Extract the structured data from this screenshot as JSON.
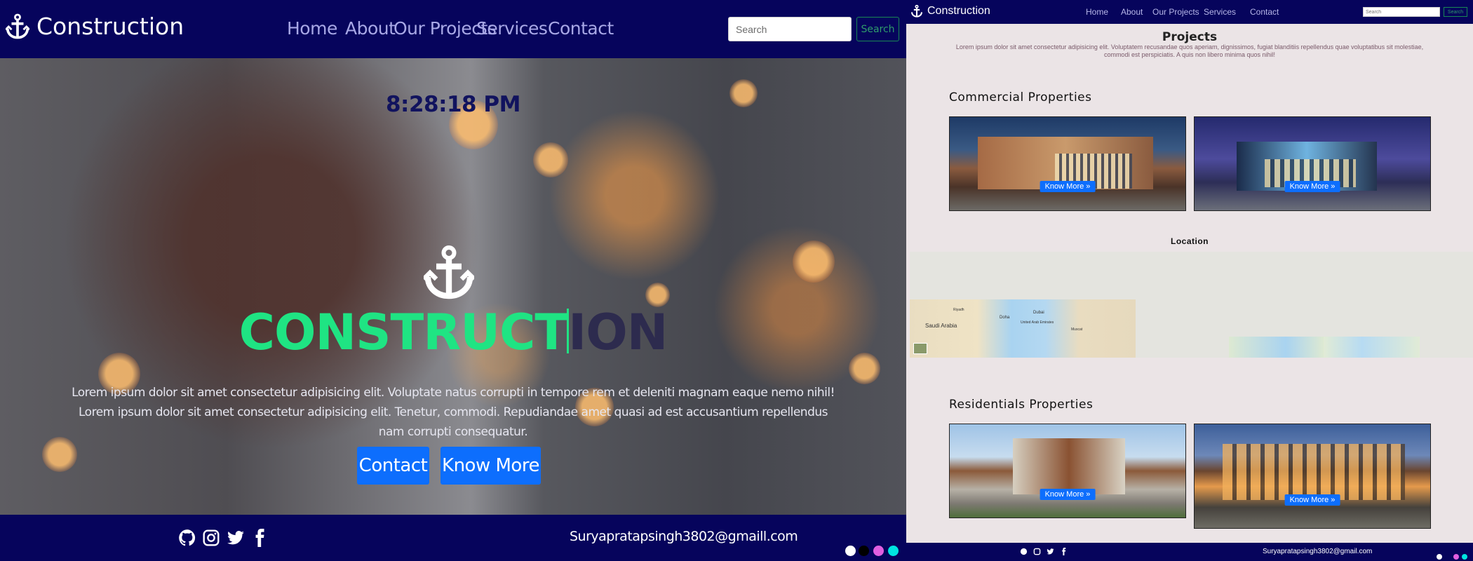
{
  "left": {
    "brand": "Construction",
    "nav": [
      "Home",
      "About",
      "Our Projects",
      "Services",
      "Contact"
    ],
    "search": {
      "placeholder": "Search",
      "button": "Search"
    },
    "clock": "8:28:18 PM",
    "hero": {
      "title_typed": "CONSTRUCT",
      "title_rest": "ION",
      "description": "Lorem ipsum dolor sit amet consectetur adipisicing elit. Voluptate natus corrupti in tempore rem et deleniti magnam eaque nemo nihil! Lorem ipsum dolor sit amet consectetur adipisicing elit. Tenetur, commodi. Repudiandae amet quasi ad est accusantium repellendus nam corrupti consequatur.",
      "buttons": [
        "Contact",
        "Know More"
      ]
    },
    "footer": {
      "social_icons": [
        "github-icon",
        "instagram-icon",
        "twitter-icon",
        "facebook-icon"
      ],
      "email": "Suryapratapsingh3802@gmaill.com"
    },
    "theme_dots": [
      "#ffffff",
      "#000000",
      "#e15fe0",
      "#00e5e0"
    ]
  },
  "right": {
    "brand": "Construction",
    "nav": [
      "Home",
      "About",
      "Our Projects",
      "Services",
      "Contact"
    ],
    "search": {
      "placeholder": "Search",
      "button": "Search"
    },
    "projects_title": "Projects",
    "projects_text": "Lorem ipsum dolor sit amet consectetur adipisicing elit. Voluptatem recusandae quos aperiam, dignissimos, fugiat blanditiis repellendus quae voluptatibus sit molestiae, commodi est perspiciatis. A quis non libero minima quos nihil!",
    "commercial_title": "Commercial Properties",
    "residential_title": "Residentials Properties",
    "know_more": "Know More »",
    "location_title": "Location",
    "map_labels": [
      "Saudi Arabia",
      "Doha",
      "Dubai",
      "United Arab Emirates",
      "Muscat",
      "Riyadh"
    ],
    "footer_email": "Suryapratapsingh3802@gmail.com",
    "theme_dots": [
      "#ffffff",
      "#06045c",
      "#e15fe0",
      "#00e5e0"
    ]
  },
  "colors": {
    "navy": "#06045c",
    "accent_green": "#1fe483",
    "primary_blue": "#0d6efd",
    "right_bg": "#ebe4e6"
  }
}
